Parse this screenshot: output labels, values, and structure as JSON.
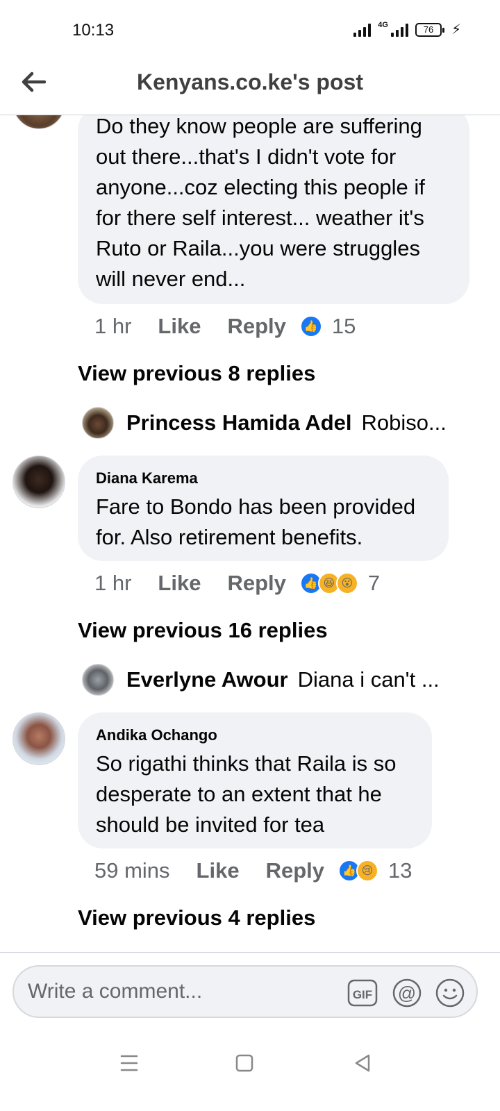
{
  "status_bar": {
    "time": "10:13",
    "network": "4G",
    "battery": "76"
  },
  "header": {
    "title": "Kenyans.co.ke's post"
  },
  "comments": [
    {
      "name": "",
      "text": "Do they know people are suffering out there...that's I didn't vote for anyone...coz electing this people if for there self interest... weather it's Ruto or Raila...you were struggles will never end...",
      "time": "1 hr",
      "like_label": "Like",
      "reply_label": "Reply",
      "reactions": [
        "like"
      ],
      "reaction_count": "15",
      "view_previous": "View previous 8 replies",
      "reply_preview": {
        "name": "Princess Hamida Adel",
        "text": "Robiso..."
      }
    },
    {
      "name": "Diana Karema",
      "text": "Fare to Bondo has been provided for. Also retirement benefits.",
      "time": "1 hr",
      "like_label": "Like",
      "reply_label": "Reply",
      "reactions": [
        "like",
        "haha",
        "wow"
      ],
      "reaction_count": "7",
      "view_previous": "View previous 16 replies",
      "reply_preview": {
        "name": "Everlyne Awour",
        "text": "Diana i can't  ..."
      }
    },
    {
      "name": "Andika Ochango",
      "text": "So rigathi thinks that Raila is so desperate to an extent that he should be invited for tea",
      "time": "59 mins",
      "like_label": "Like",
      "reply_label": "Reply",
      "reactions": [
        "like",
        "sad"
      ],
      "reaction_count": "13",
      "view_previous": "View previous 4 replies"
    }
  ],
  "composer": {
    "placeholder": "Write a comment..."
  },
  "icons": {
    "back": "arrow-left-icon",
    "gif": "gif-icon",
    "mention": "at-icon",
    "emoji": "smiley-icon",
    "nav_menu": "menu-icon",
    "nav_home": "square-icon",
    "nav_back": "triangle-back-icon"
  },
  "colors": {
    "bubble": "#f0f2f5",
    "like_blue": "#1877f2",
    "muted_text": "#65676b"
  }
}
